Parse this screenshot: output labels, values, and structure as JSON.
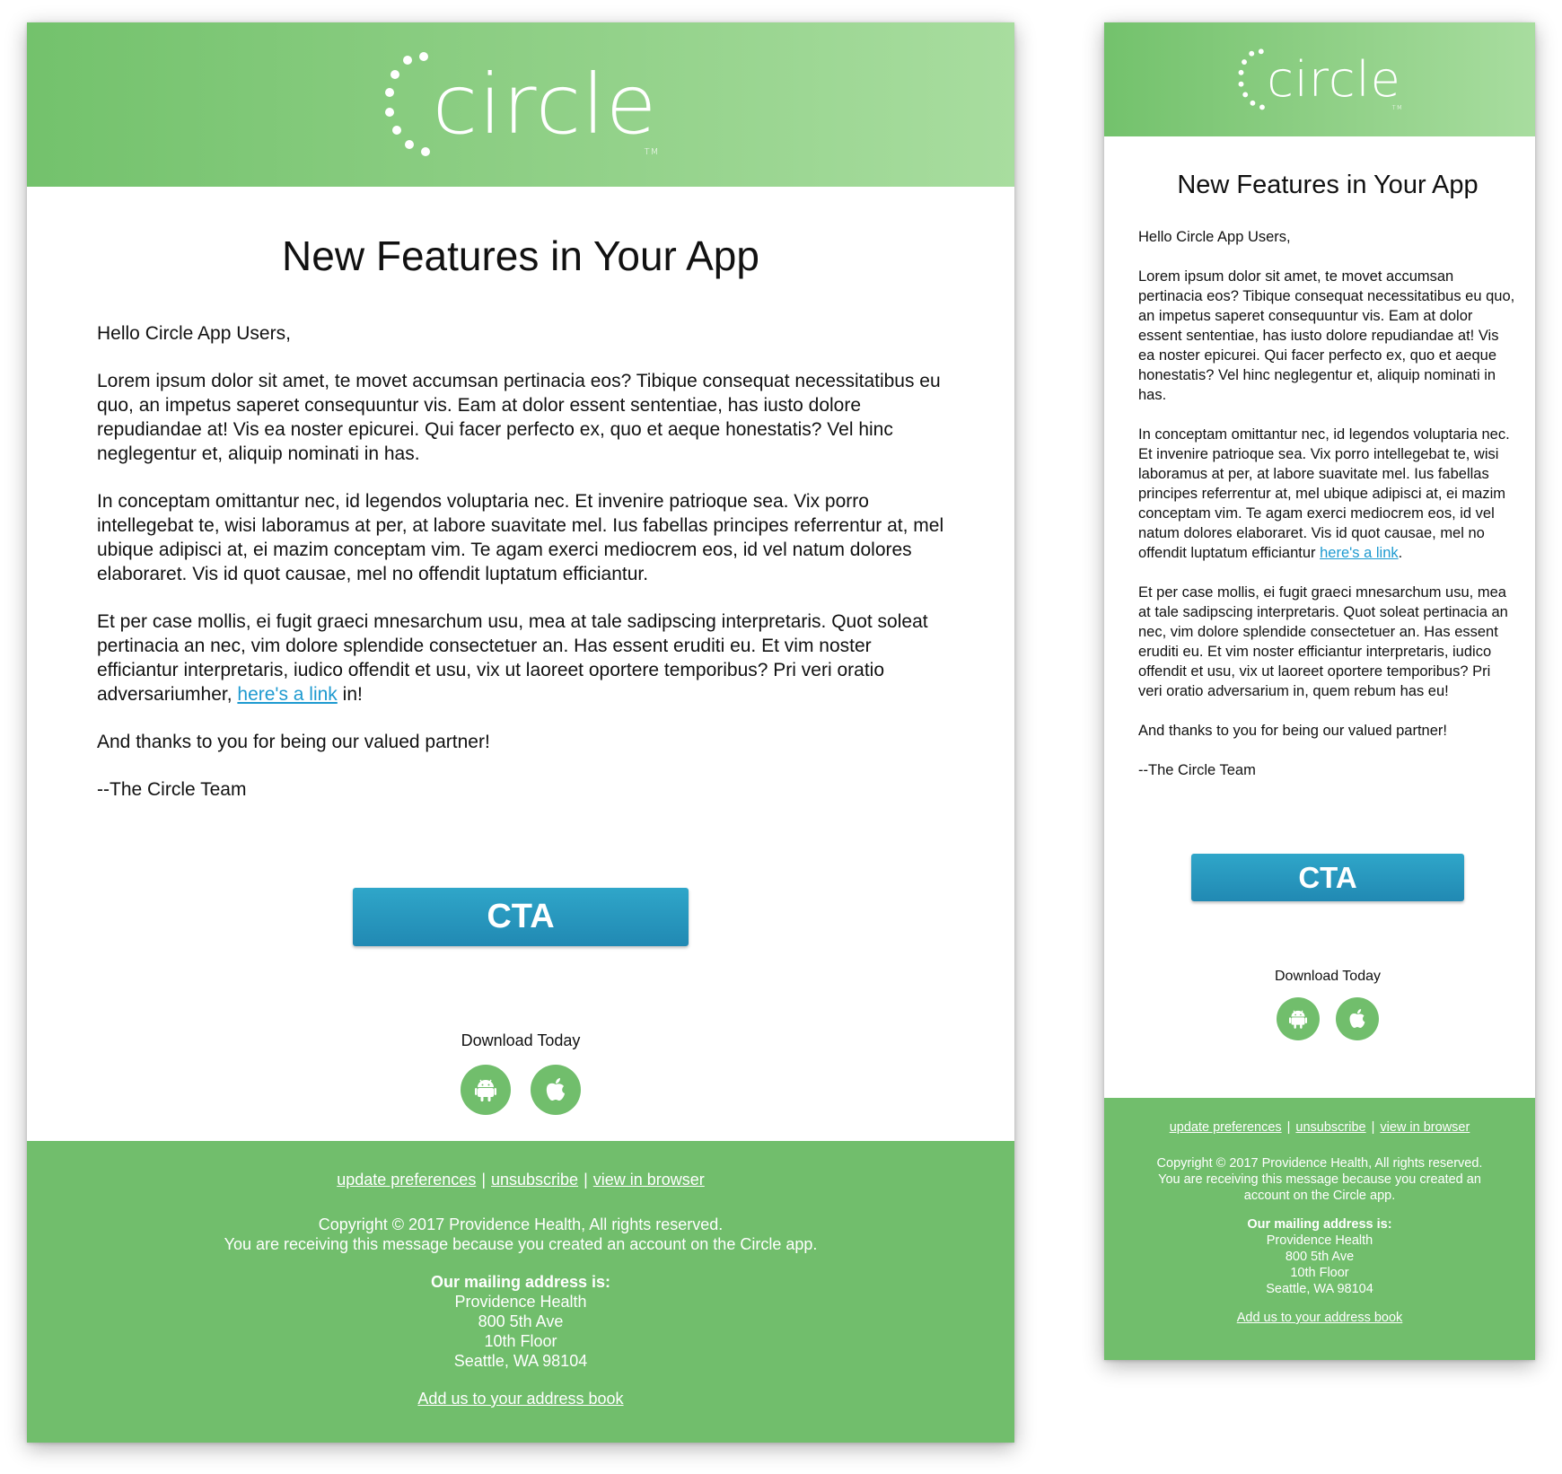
{
  "brand": {
    "name": "circle",
    "tm": "TM",
    "colors": {
      "header_start": "#73c26c",
      "header_end": "#a8dd9f",
      "footer": "#71be6c",
      "cta": "#2697c0",
      "link": "#1e9ad0"
    }
  },
  "desktop": {
    "title": "New Features in Your App",
    "greeting": "Hello Circle App Users,",
    "para1": "Lorem ipsum dolor sit amet, te movet accumsan pertinacia eos? Tibique consequat necessitatibus eu quo, an impetus saperet consequuntur vis. Eam at dolor essent sententiae, has iusto dolore repudiandae at! Vis ea noster epicurei. Qui facer perfecto ex, quo et aeque honestatis? Vel hinc neglegentur et, aliquip nominati in has.",
    "para2": "In conceptam omittantur nec, id legendos voluptaria nec. Et invenire patrioque sea. Vix porro intellegebat te, wisi laboramus at per, at labore suavitate mel. Ius fabellas principes referrentur at, mel ubique adipisci at, ei mazim conceptam vim. Te agam exerci mediocrem eos, id vel natum dolores elaboraret. Vis id quot causae, mel no offendit luptatum efficiantur.",
    "para3_before": "Et per case mollis, ei fugit graeci mnesarchum usu, mea at tale sadipscing interpretaris. Quot soleat pertinacia an nec, vim dolore splendide consectetuer an. Has essent eruditi eu. Et vim noster efficiantur interpretaris, iudico offendit et usu, vix ut laoreet oportere temporibus? Pri veri oratio adversariumher, ",
    "para3_link": "here's a link",
    "para3_after": " in!",
    "thanks": "And thanks to you for being our valued partner!",
    "signoff": "--The Circle Team",
    "cta": "CTA",
    "download": "Download Today"
  },
  "mobile": {
    "title": "New Features in Your App",
    "greeting": "Hello Circle App Users,",
    "para1": "Lorem ipsum dolor sit amet, te movet accumsan pertinacia eos? Tibique consequat necessitatibus eu quo, an impetus saperet consequuntur vis. Eam at dolor essent sententiae, has iusto dolore repudiandae at! Vis ea noster epicurei. Qui facer perfecto ex, quo et aeque honestatis? Vel hinc neglegentur et, aliquip nominati in has.",
    "para2_before": "In conceptam omittantur nec, id legendos voluptaria nec. Et invenire patrioque sea. Vix porro intellegebat te, wisi laboramus at per, at labore suavitate mel. Ius fabellas principes referrentur at, mel ubique adipisci at, ei mazim conceptam vim. Te agam exerci mediocrem eos, id vel natum dolores elaboraret. Vis id quot causae, mel no offendit luptatum efficiantur ",
    "para2_link": "here's a link",
    "para2_after": ".",
    "para3": "Et per case mollis, ei fugit graeci mnesarchum usu, mea at tale sadipscing interpretaris. Quot soleat pertinacia an nec, vim dolore splendide consectetuer an. Has essent eruditi eu. Et vim noster efficiantur interpretaris, iudico offendit et usu, vix ut laoreet oportere temporibus? Pri veri oratio adversarium in, quem rebum has eu!",
    "thanks": "And thanks to you for being our valued partner!",
    "signoff": "--The Circle Team",
    "cta": "CTA",
    "download": "Download Today"
  },
  "footer": {
    "link_update": "update preferences",
    "separator": "|",
    "link_unsubscribe": "unsubscribe",
    "link_browser": "view in browser",
    "copyright": "Copyright © 2017 Providence Health, All rights reserved.",
    "reason": "You are receiving this message because you created an account on the Circle app.",
    "mailing_heading": "Our mailing address is:",
    "address_line1": "Providence Health",
    "address_line2": "800 5th Ave",
    "address_line3": "10th Floor",
    "address_line4": "Seattle, WA 98104",
    "address_book": "Add us to your address book"
  },
  "icons": {
    "android": "android-icon",
    "apple": "apple-icon",
    "logo_dots": "dot-ring-icon"
  }
}
